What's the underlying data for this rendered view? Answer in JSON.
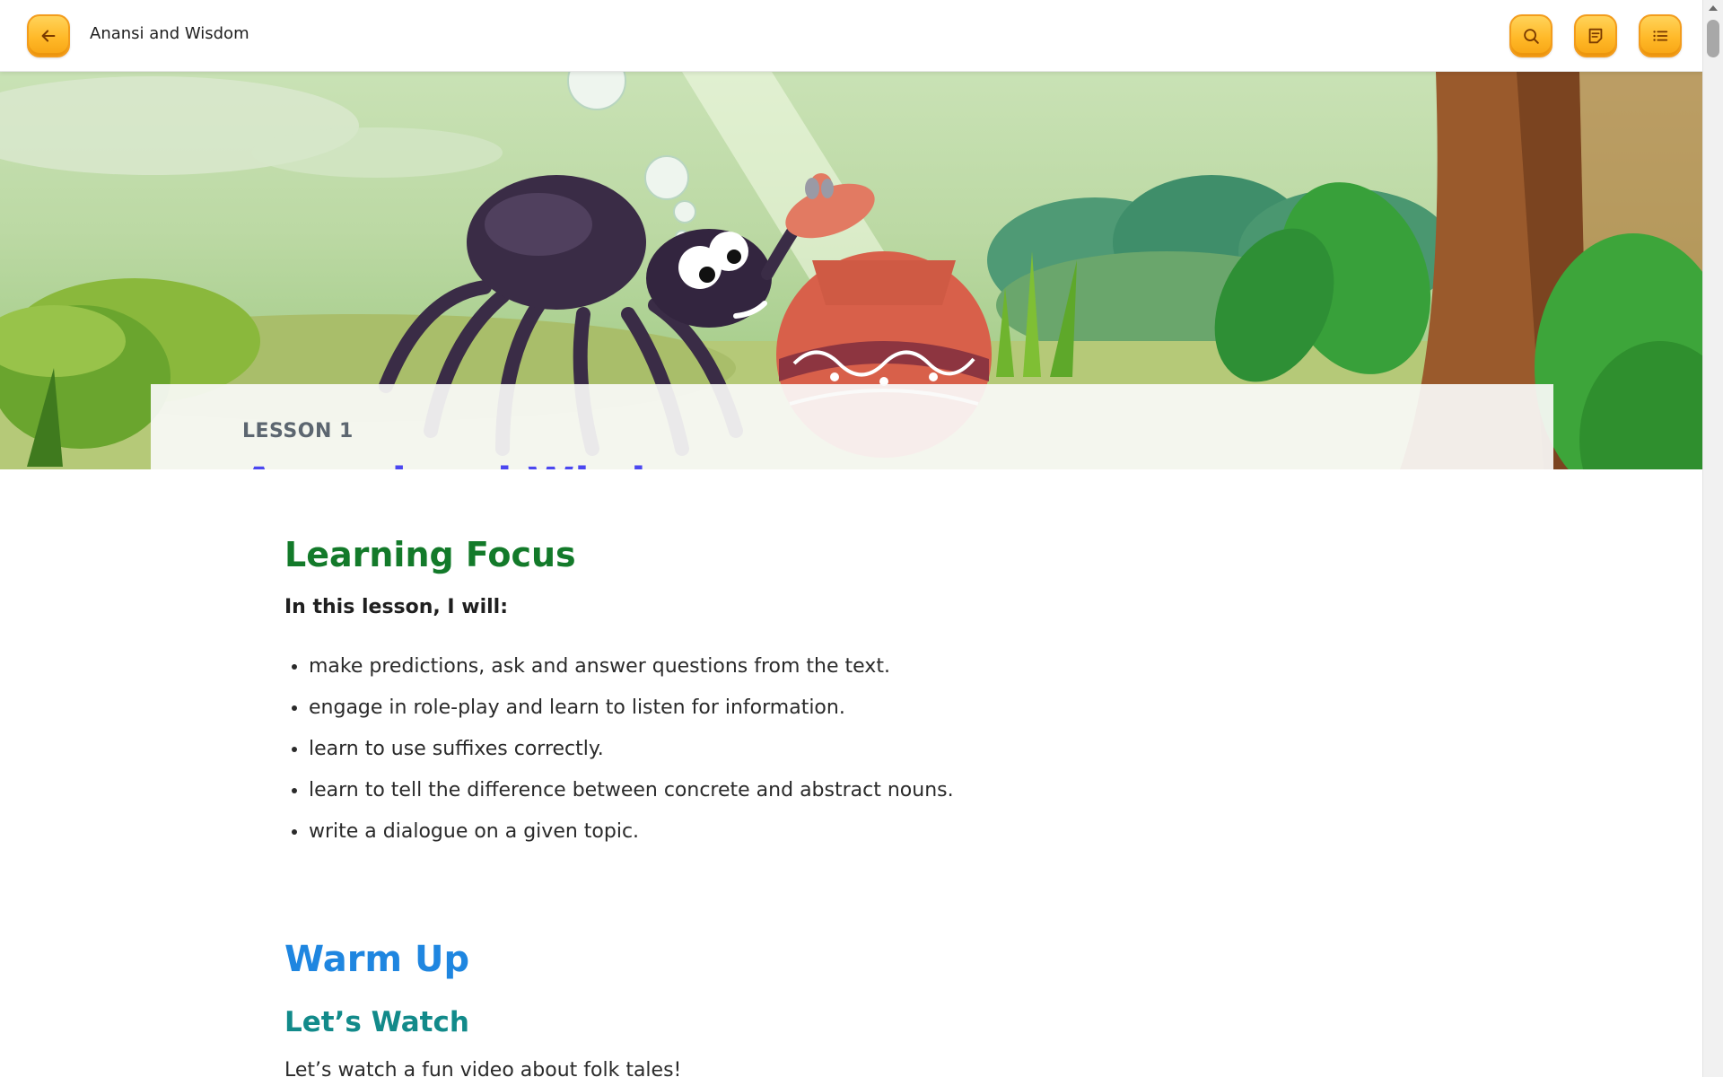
{
  "header": {
    "title": "Anansi and Wisdom",
    "back_icon": "arrow-left-icon",
    "search_icon": "search-icon",
    "notes_icon": "notes-icon",
    "menu_icon": "list-icon",
    "button_color": "#ffb928"
  },
  "hero": {
    "kicker": "LESSON 1",
    "title": "Anansi and Wisdom"
  },
  "learning_focus": {
    "heading": "Learning Focus",
    "intro": "In this lesson, I will:",
    "items": [
      "make predictions, ask and answer questions from the text.",
      "engage in role-play and learn to listen for information.",
      "learn to use suffixes correctly.",
      "learn to tell the difference between concrete and abstract nouns.",
      "write a dialogue on a given topic."
    ]
  },
  "warm_up": {
    "heading": "Warm Up",
    "subheading": "Let’s Watch",
    "text": "Let’s watch a fun video about folk tales!"
  },
  "colors": {
    "lesson_title": "#4b47f0",
    "focus_heading": "#137a2a",
    "warm_heading": "#1f86e0",
    "watch_heading": "#128a8a"
  }
}
